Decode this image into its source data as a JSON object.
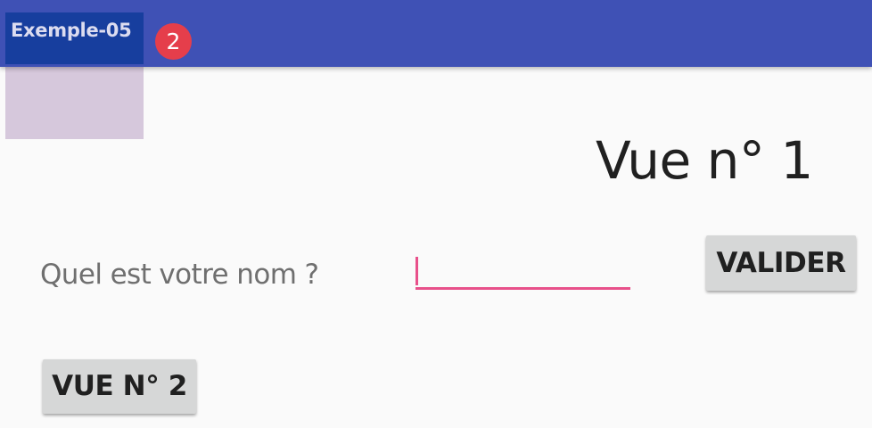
{
  "app_bar": {
    "title": "Exemple-05",
    "badge_count": "2",
    "color": "#3f51b5"
  },
  "main": {
    "view_title": "Vue n° 1",
    "name_label": "Quel est votre nom ?",
    "name_input": {
      "value": "",
      "placeholder": ""
    },
    "validate_button": "VALIDER",
    "view2_button": "VUE N° 2"
  },
  "colors": {
    "accent": "#e8508a",
    "badge": "#e53e4b",
    "button": "#d6d7d7"
  }
}
